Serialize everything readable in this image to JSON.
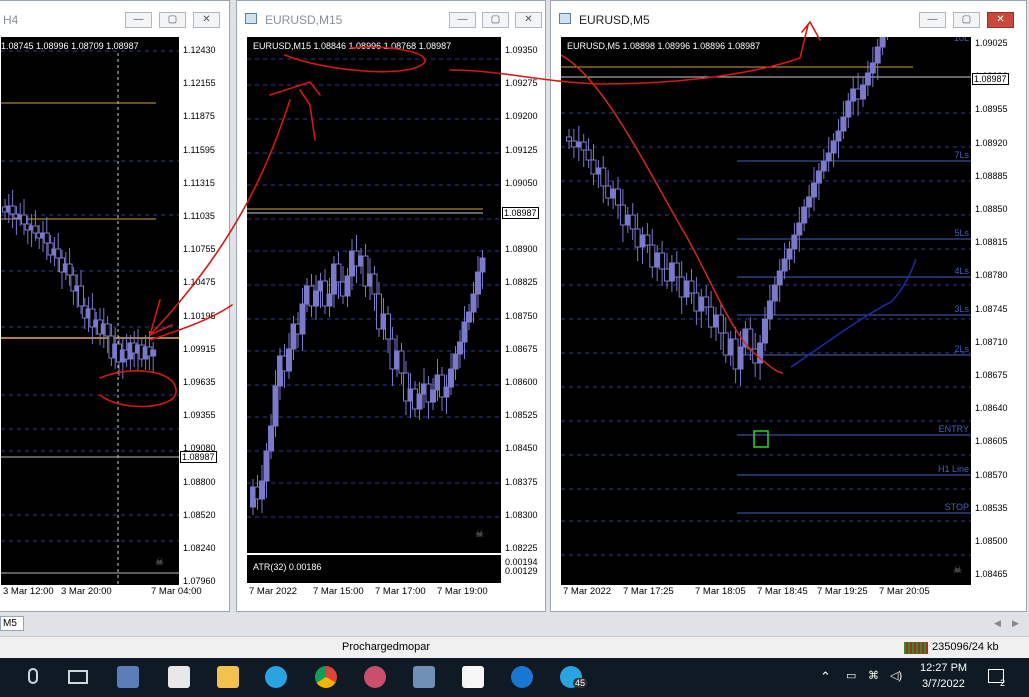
{
  "windows": [
    {
      "title": "H4",
      "symbol_header": "1.08745 1.08996 1.08709 1.08987",
      "prices": [
        "1.12430",
        "1.12155",
        "1.11875",
        "1.11595",
        "1.11315",
        "1.11035",
        "1.10755",
        "1.10475",
        "1.10195",
        "1.09915",
        "1.09635",
        "1.09355",
        "1.09080",
        "1.08800",
        "1.08520",
        "1.08240",
        "1.07960"
      ],
      "current_price": "1.08987",
      "times": [
        "3 Mar 12:00",
        "3 Mar 20:00",
        "7 Mar 04:00"
      ]
    },
    {
      "title": "EURUSD,M15",
      "symbol_header": "EURUSD,M15 1.08846 1.08996 1.08768 1.08987",
      "prices": [
        "1.09350",
        "1.09275",
        "1.09200",
        "1.09125",
        "1.09050",
        "1.08975",
        "1.08900",
        "1.08825",
        "1.08750",
        "1.08675",
        "1.08600",
        "1.08525",
        "1.08450",
        "1.08375",
        "1.08300",
        "1.08225"
      ],
      "current_price": "1.08987",
      "indicator": "ATR(32) 0.00186",
      "indicator_scale": [
        "0.00194",
        "0.00129"
      ],
      "times": [
        "7 Mar 2022",
        "7 Mar 15:00",
        "7 Mar 17:00",
        "7 Mar 19:00"
      ]
    },
    {
      "title": "EURUSD,M5",
      "symbol_header": "EURUSD,M5 1.08898 1.08996 1.08896 1.08987",
      "prices": [
        "1.09025",
        "1.08990",
        "1.08955",
        "1.08920",
        "1.08885",
        "1.08850",
        "1.08815",
        "1.08780",
        "1.08745",
        "1.08710",
        "1.08675",
        "1.08640",
        "1.08605",
        "1.08570",
        "1.08535",
        "1.08500",
        "1.08465"
      ],
      "current_price": "1.08987",
      "levels": [
        "10L",
        "7Ls",
        "5Ls",
        "4Ls",
        "3Ls",
        "2Ls",
        "ENTRY",
        "H1 Line",
        "STOP"
      ],
      "times": [
        "7 Mar 2022",
        "7 Mar 17:25",
        "7 Mar 18:05",
        "7 Mar 18:45",
        "7 Mar 19:25",
        "7 Mar 20:05"
      ]
    }
  ],
  "tab": {
    "label": "M5"
  },
  "status": {
    "profile": "Prochargedmopar",
    "traffic": "235096/24 kb"
  },
  "taskbar": {
    "time": "12:27 PM",
    "date": "3/7/2022",
    "badge": "45",
    "notif": "2"
  },
  "colors": {
    "candle": "#7b79c9",
    "hline": "#d4a04a",
    "level": "#4a5fc0",
    "ma_red": "#d12a1f",
    "ma_blue": "#1d2ca8",
    "annotation": "#d11a12"
  }
}
